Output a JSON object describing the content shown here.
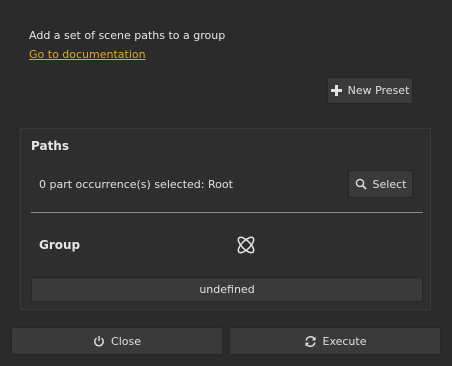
{
  "header": {
    "description": "Add a set of scene paths to a group",
    "doc_link": "Go to documentation"
  },
  "toolbar": {
    "new_preset_label": "New Preset",
    "new_preset_icon": "plus-icon"
  },
  "paths_panel": {
    "title": "Paths",
    "selection_text": "0 part occurrence(s) selected: Root",
    "select_label": "Select",
    "select_icon": "magnifier-icon",
    "group_label": "Group",
    "group_icon": "atom-icon",
    "group_value": "undefined"
  },
  "footer": {
    "close_label": "Close",
    "close_icon": "power-icon",
    "execute_label": "Execute",
    "execute_icon": "refresh-icon"
  },
  "colors": {
    "background": "#2b2b2b",
    "link": "#e8a52a",
    "button": "#3a3a3a"
  }
}
